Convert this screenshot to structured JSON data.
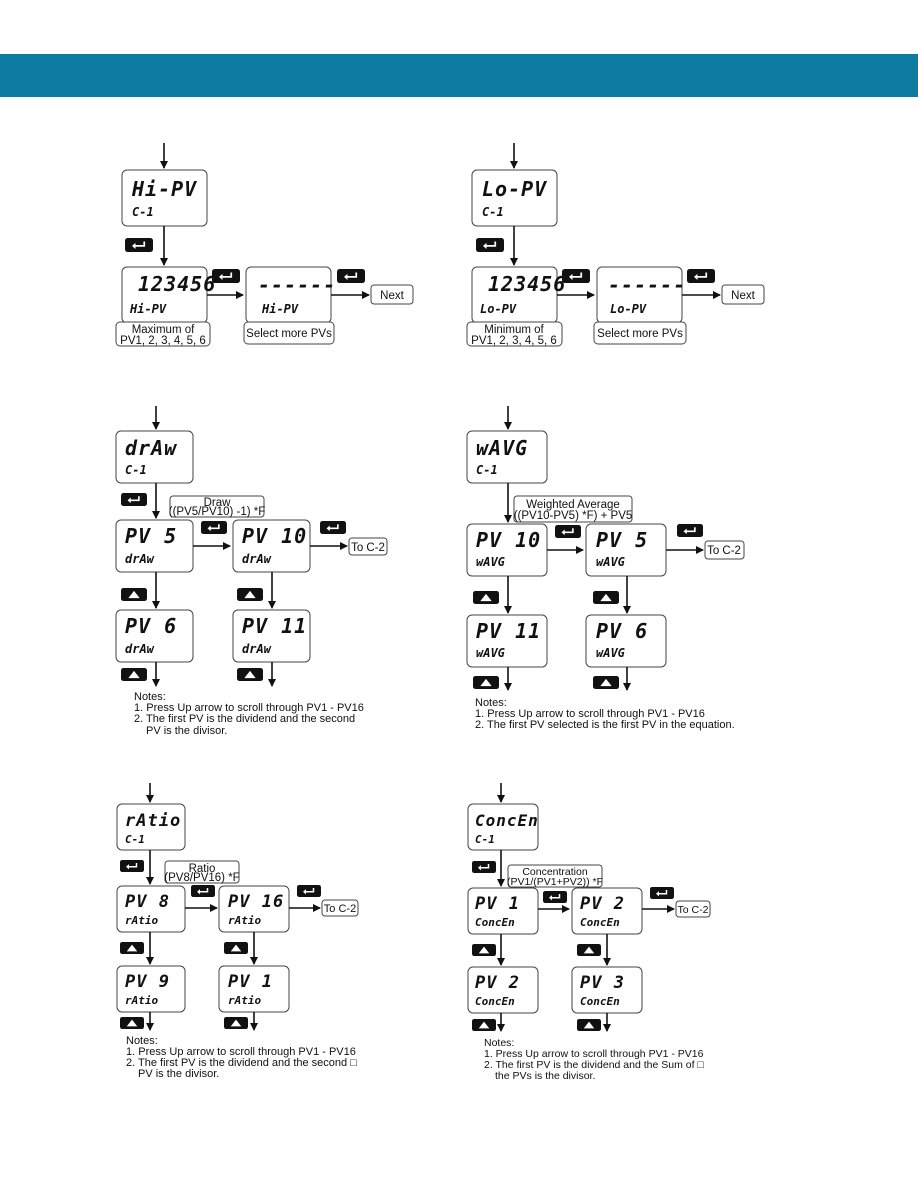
{
  "header": {
    "color": "#0E7CA0"
  },
  "colors": {
    "line": "#111111",
    "key_bg": "#111111",
    "box_border": "#444444"
  },
  "icons": {
    "enter_key": "enter-key-icon",
    "up_key": "up-arrow-key-icon"
  },
  "panels": {
    "hi_pv": {
      "top_display": {
        "main": "Hi-PV",
        "sub": "C-1"
      },
      "value_display": {
        "main": "123456",
        "sub": "Hi-PV"
      },
      "select_display": {
        "main": "------",
        "sub": "Hi-PV"
      },
      "value_caption_1": "Maximum of",
      "value_caption_2": "PV1, 2, 3, 4, 5, 6",
      "select_caption": "Select more PVs",
      "next_label": "Next"
    },
    "lo_pv": {
      "top_display": {
        "main": "Lo-PV",
        "sub": "C-1"
      },
      "value_display": {
        "main": "123456",
        "sub": "Lo-PV"
      },
      "select_display": {
        "main": "------",
        "sub": "Lo-PV"
      },
      "value_caption_1": "Minimum of",
      "value_caption_2": "PV1, 2, 3, 4, 5, 6",
      "select_caption": "Select more PVs",
      "next_label": "Next"
    },
    "draw": {
      "top_display": {
        "main": "drAw",
        "sub": "C-1"
      },
      "formula_1": "Draw",
      "formula_2": "((PV5/PV10) -1) *F",
      "first_display": {
        "main": "PV 5",
        "sub": "drAw"
      },
      "second_display": {
        "main": "PV 10",
        "sub": "drAw"
      },
      "first_next_display": {
        "main": "PV 6",
        "sub": "drAw"
      },
      "second_next_display": {
        "main": "PV 11",
        "sub": "drAw"
      },
      "goto_label": "To C-2",
      "notes_title": "Notes:",
      "note_1": "1. Press Up arrow to scroll through PV1 - PV16",
      "note_2a": "2. The first PV is the dividend and the second",
      "note_2b": "PV is the divisor."
    },
    "w_avg": {
      "top_display": {
        "main": "wAVG",
        "sub": "C-1"
      },
      "formula_1": "Weighted Average",
      "formula_2": "((PV10-PV5) *F) + PV5",
      "first_display": {
        "main": "PV 10",
        "sub": "wAVG"
      },
      "second_display": {
        "main": "PV 5",
        "sub": "wAVG"
      },
      "first_next_display": {
        "main": "PV 11",
        "sub": "wAVG"
      },
      "second_next_display": {
        "main": "PV 6",
        "sub": "wAVG"
      },
      "goto_label": "To C-2",
      "notes_title": "Notes:",
      "note_1": "1. Press Up arrow to scroll through PV1 - PV16",
      "note_2a": "2. The first PV selected is the first PV in the equation.",
      "note_2b": ""
    },
    "ratio": {
      "top_display": {
        "main": "rAtio",
        "sub": "C-1"
      },
      "formula_1": "Ratio",
      "formula_2": "(PV8/PV16) *F",
      "first_display": {
        "main": "PV 8",
        "sub": "rAtio"
      },
      "second_display": {
        "main": "PV 16",
        "sub": "rAtio"
      },
      "first_next_display": {
        "main": "PV 9",
        "sub": "rAtio"
      },
      "second_next_display": {
        "main": "PV 1",
        "sub": "rAtio"
      },
      "goto_label": "To C-2",
      "notes_title": "Notes:",
      "note_1": "1. Press Up arrow to scroll through PV1 - PV16",
      "note_2a": "2. The first PV is the dividend and the second □",
      "note_2b": "PV is the divisor."
    },
    "concen": {
      "top_display": {
        "main": "ConcEn",
        "sub": "C-1"
      },
      "formula_1": "Concentration",
      "formula_2": "(PV1/(PV1+PV2)) *F",
      "first_display": {
        "main": "PV 1",
        "sub": "ConcEn"
      },
      "second_display": {
        "main": "PV 2",
        "sub": "ConcEn"
      },
      "first_next_display": {
        "main": "PV 2",
        "sub": "ConcEn"
      },
      "second_next_display": {
        "main": "PV 3",
        "sub": "ConcEn"
      },
      "goto_label": "To C-2",
      "notes_title": "Notes:",
      "note_1": "1. Press Up arrow to scroll through PV1 - PV16",
      "note_2a": "2. The first PV is the dividend and the Sum of □",
      "note_2b": "the PVs is the divisor."
    }
  }
}
